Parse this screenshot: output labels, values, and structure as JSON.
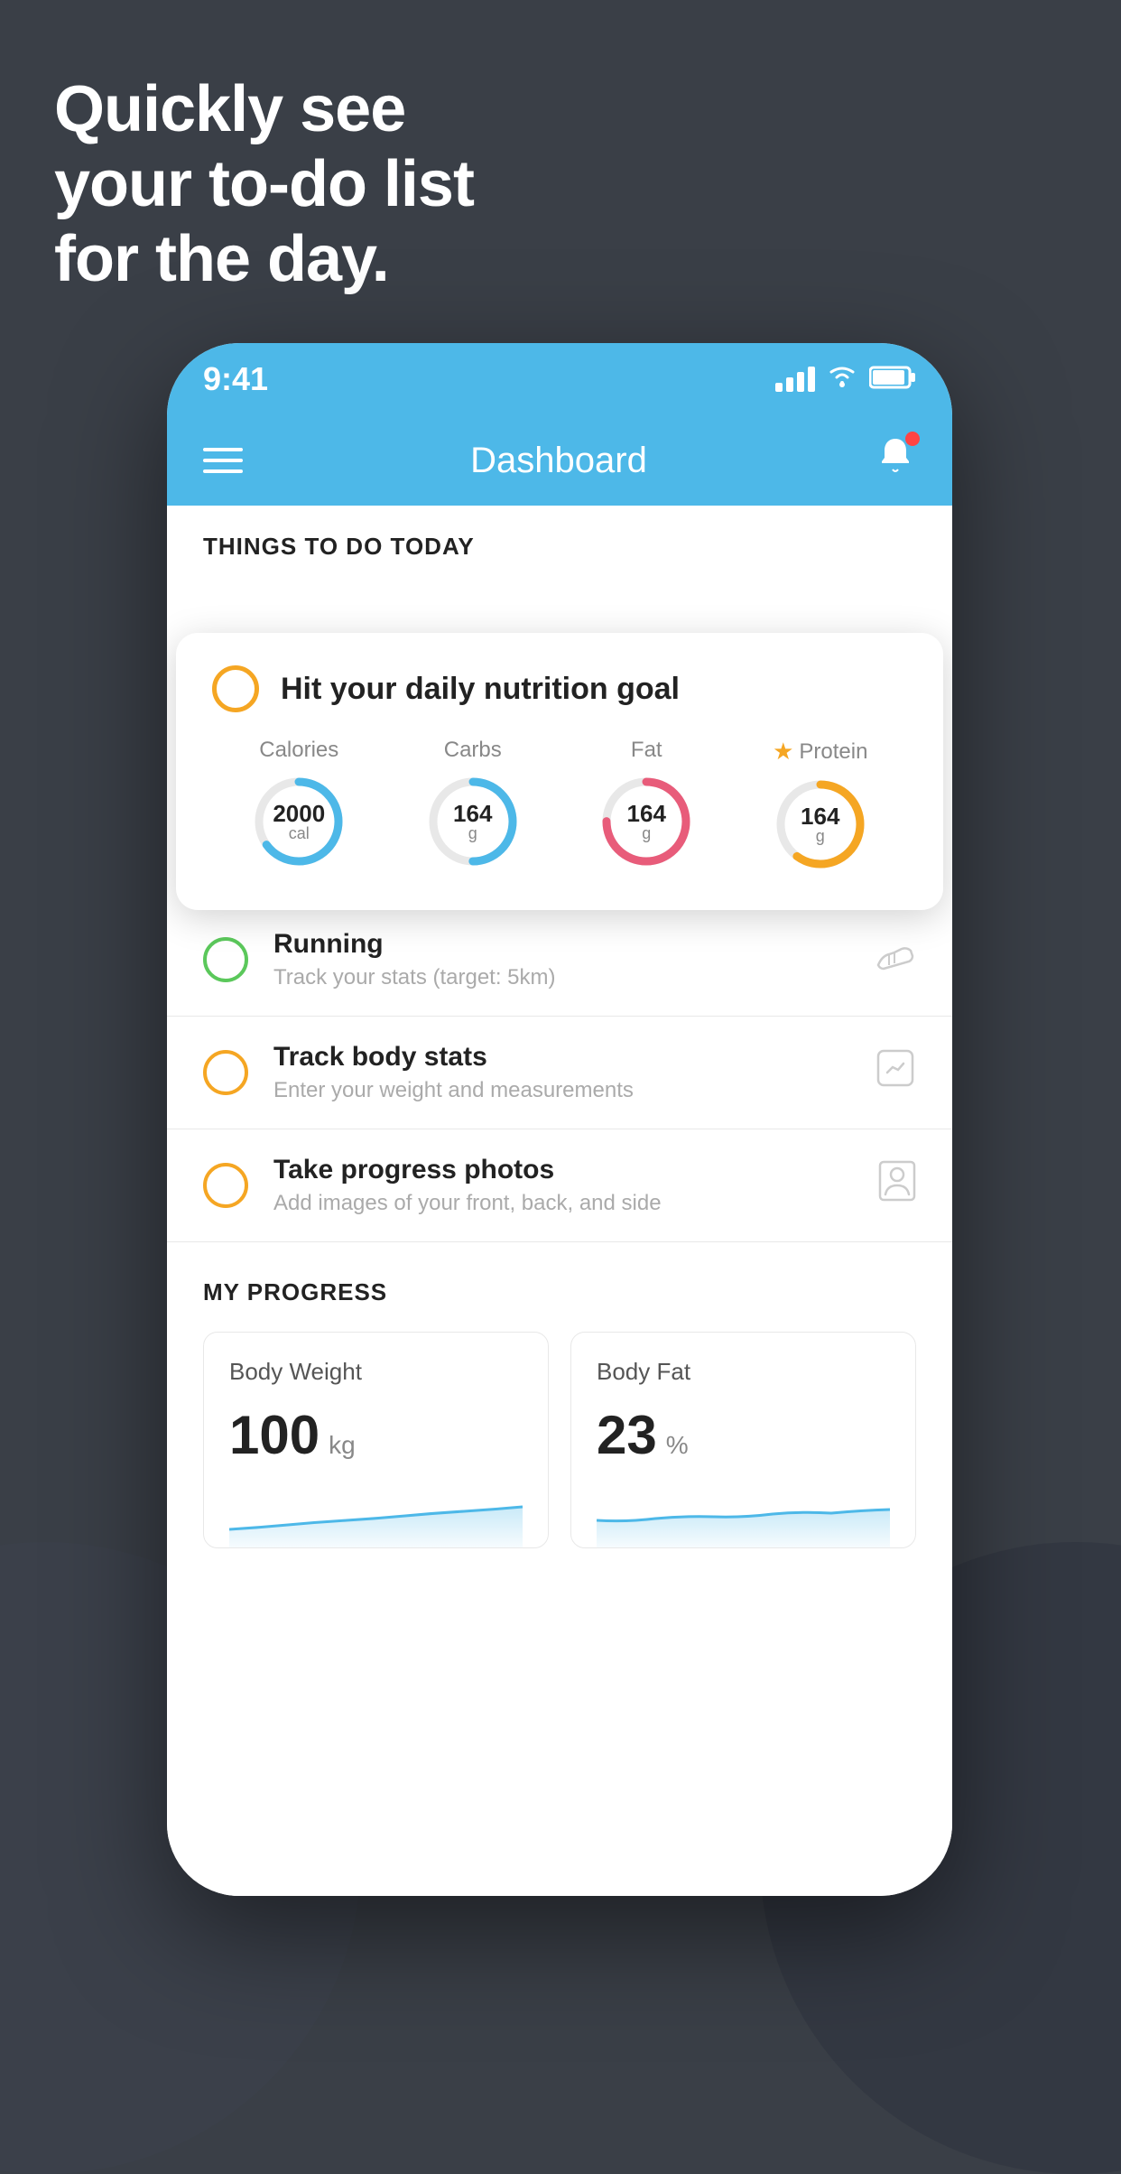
{
  "background": {
    "color": "#3a3f47"
  },
  "headline": {
    "line1": "Quickly see",
    "line2": "your to-do list",
    "line3": "for the day."
  },
  "phone": {
    "status_bar": {
      "time": "9:41",
      "signal": "signal",
      "wifi": "wifi",
      "battery": "battery"
    },
    "nav": {
      "title": "Dashboard",
      "menu_label": "menu",
      "bell_label": "notifications"
    },
    "section1": {
      "header": "THINGS TO DO TODAY"
    },
    "floating_card": {
      "title": "Hit your daily nutrition goal",
      "stats": [
        {
          "label": "Calories",
          "value": "2000",
          "unit": "cal",
          "color": "#4db8e8",
          "pct": 65
        },
        {
          "label": "Carbs",
          "value": "164",
          "unit": "g",
          "color": "#4db8e8",
          "pct": 50
        },
        {
          "label": "Fat",
          "value": "164",
          "unit": "g",
          "color": "#e85c7a",
          "pct": 75
        },
        {
          "label": "Protein",
          "value": "164",
          "unit": "g",
          "color": "#f5a623",
          "pct": 60,
          "starred": true
        }
      ]
    },
    "todo_items": [
      {
        "title": "Running",
        "subtitle": "Track your stats (target: 5km)",
        "circle_color": "green",
        "icon": "shoe"
      },
      {
        "title": "Track body stats",
        "subtitle": "Enter your weight and measurements",
        "circle_color": "yellow",
        "icon": "scale"
      },
      {
        "title": "Take progress photos",
        "subtitle": "Add images of your front, back, and side",
        "circle_color": "yellow",
        "icon": "camera"
      }
    ],
    "progress": {
      "header": "MY PROGRESS",
      "cards": [
        {
          "title": "Body Weight",
          "value": "100",
          "unit": "kg"
        },
        {
          "title": "Body Fat",
          "value": "23",
          "unit": "%"
        }
      ]
    }
  }
}
